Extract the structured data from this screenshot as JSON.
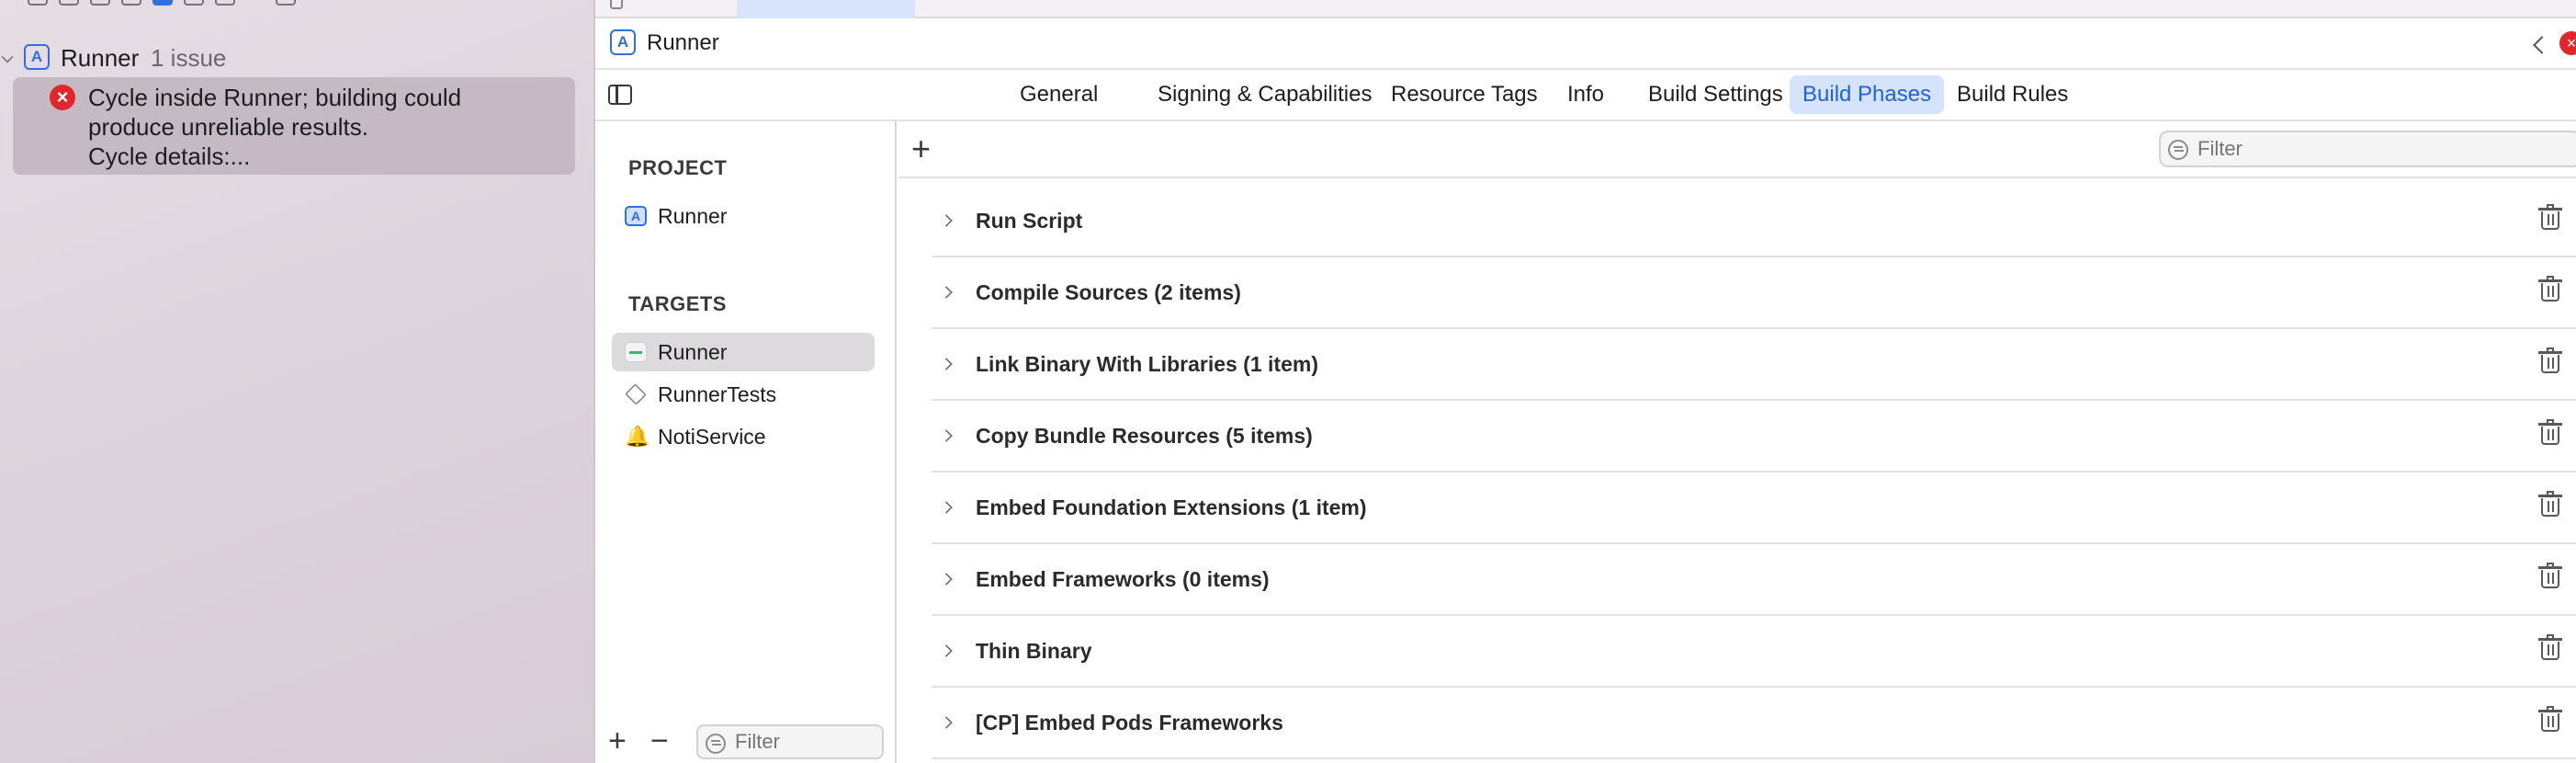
{
  "issue_navigator": {
    "group": {
      "title": "Runner",
      "count": "1 issue",
      "icon": "app-project-icon"
    },
    "issue": {
      "severity": "error",
      "line1": "Cycle inside Runner; building could",
      "line2": "produce unreliable results.",
      "line3": "Cycle details:..."
    }
  },
  "jump_bar": {
    "title": "Runner"
  },
  "tabs": [
    {
      "label": "General",
      "selected": false
    },
    {
      "label": "Signing & Capabilities",
      "selected": false
    },
    {
      "label": "Resource Tags",
      "selected": false
    },
    {
      "label": "Info",
      "selected": false
    },
    {
      "label": "Build Settings",
      "selected": false
    },
    {
      "label": "Build Phases",
      "selected": true
    },
    {
      "label": "Build Rules",
      "selected": false
    }
  ],
  "targets_panel": {
    "project_header": "PROJECT",
    "project_item": "Runner",
    "targets_header": "TARGETS",
    "targets": [
      {
        "label": "Runner",
        "icon": "flutter-app-icon",
        "selected": true
      },
      {
        "label": "RunnerTests",
        "icon": "tests-icon",
        "selected": false
      },
      {
        "label": "NotiService",
        "icon": "notification-bell-icon",
        "selected": false
      }
    ],
    "filter_placeholder": "Filter"
  },
  "phases": {
    "filter_placeholder": "Filter",
    "items": [
      "Run Script",
      "Compile Sources (2 items)",
      "Link Binary With Libraries (1 item)",
      "Copy Bundle Resources (5 items)",
      "Embed Foundation Extensions (1 item)",
      "Embed Frameworks (0 items)",
      "Thin Binary",
      "[CP] Embed Pods Frameworks"
    ]
  },
  "colors": {
    "accent": "#1f62d8",
    "selected_tab_bg": "#d5e4fc",
    "error": "#e2262b"
  }
}
